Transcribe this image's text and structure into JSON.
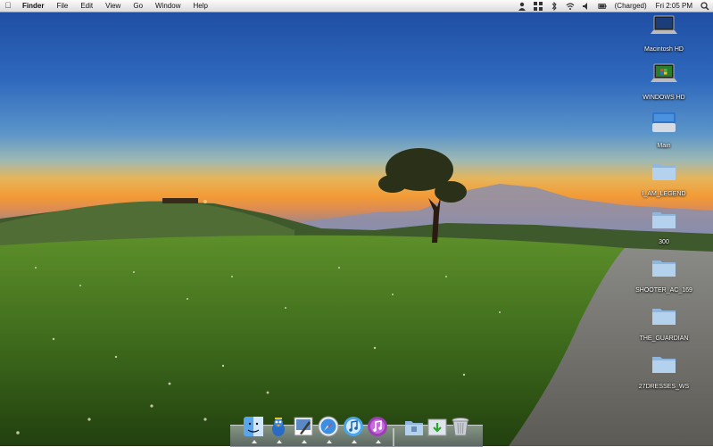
{
  "menubar": {
    "apple_icon": "apple-icon",
    "app_name": "Finder",
    "menus": [
      "File",
      "Edit",
      "View",
      "Go",
      "Window",
      "Help"
    ],
    "status_icons": [
      "user-icon",
      "grid-icon",
      "bluetooth-icon",
      "wifi-icon",
      "volume-icon",
      "battery-icon"
    ],
    "battery_text": "(Charged)",
    "clock": "Fri 2:05 PM",
    "spotlight_icon": "search-icon"
  },
  "desktop": {
    "icons": [
      {
        "label": "Macintosh HD",
        "type": "laptop-drive-icon"
      },
      {
        "label": "WINDOWS HD",
        "type": "laptop-drive-icon"
      },
      {
        "label": "Main",
        "type": "disk-icon"
      },
      {
        "label": "I_AM_LEGEND",
        "type": "folder-icon"
      },
      {
        "label": "300",
        "type": "folder-icon"
      },
      {
        "label": "SHOOTER_AC_169",
        "type": "folder-icon"
      },
      {
        "label": "THE_GUARDIAN",
        "type": "folder-icon"
      },
      {
        "label": "27DRESSES_WS",
        "type": "folder-icon"
      }
    ]
  },
  "dock": {
    "items": [
      "finder-icon",
      "adium-icon",
      "preview-icon",
      "safari-icon",
      "itunes-icon",
      "itunes-alt-icon",
      "applications-stack-icon",
      "downloads-stack-icon",
      "trash-icon"
    ]
  },
  "colors": {
    "sky_top": "#1f4fa6",
    "horizon_orange": "#f3a13c",
    "grass": "#4f7e22",
    "folder_blue": "#a9c9e8"
  }
}
